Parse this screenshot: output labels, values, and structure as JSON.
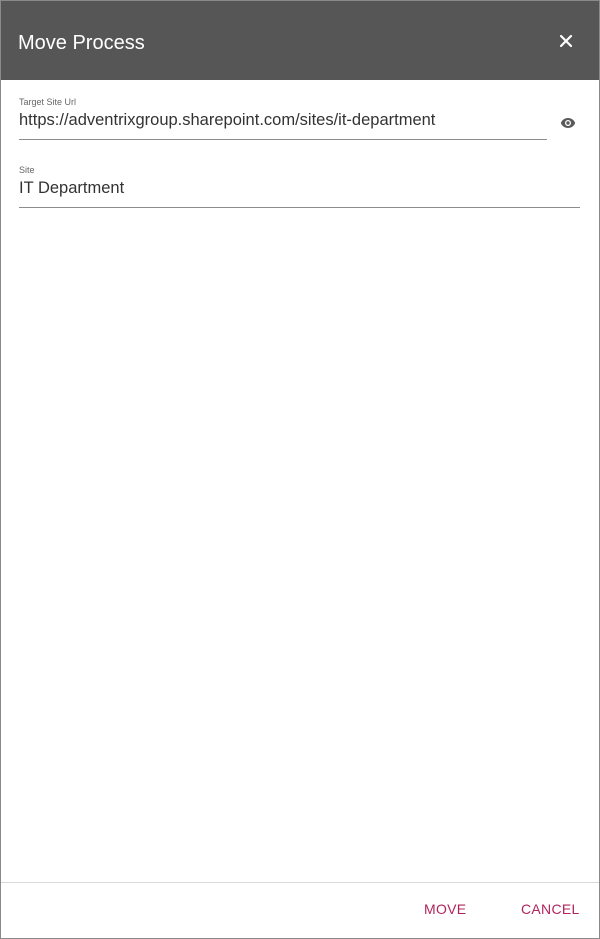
{
  "dialog": {
    "title": "Move Process"
  },
  "fields": {
    "target_site_url": {
      "label": "Target Site Url",
      "value": "https://adventrixgroup.sharepoint.com/sites/it-department"
    },
    "site": {
      "label": "Site",
      "value": "IT Department"
    }
  },
  "footer": {
    "move_label": "MOVE",
    "cancel_label": "CANCEL"
  },
  "icons": {
    "close": "close-icon",
    "eye": "eye-icon"
  },
  "colors": {
    "header_bg": "#565656",
    "accent": "#b0245c",
    "text": "#333333"
  }
}
